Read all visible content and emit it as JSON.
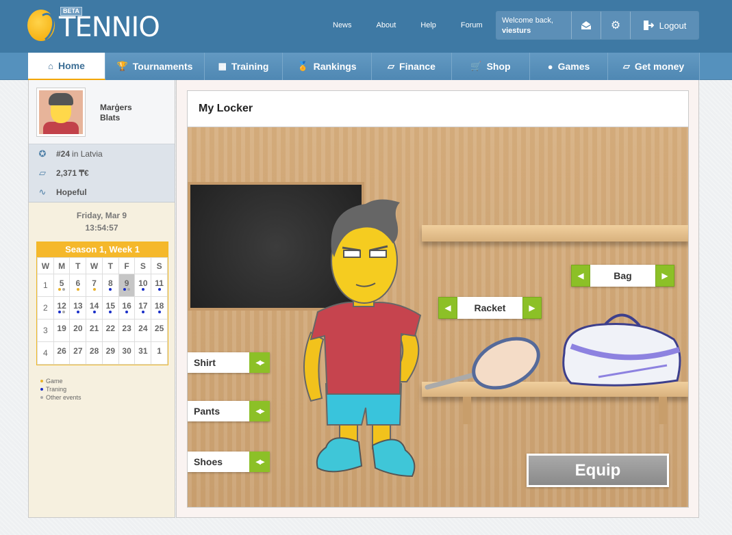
{
  "logo": {
    "text": "TENNIO",
    "badge": "BETA"
  },
  "toplinks": [
    "News",
    "About",
    "Help",
    "Forum"
  ],
  "user": {
    "welcome": "Welcome back,",
    "username": "viesturs",
    "logout": "Logout"
  },
  "nav": [
    {
      "label": "Home",
      "icon": "⌂",
      "width": 113,
      "active": true
    },
    {
      "label": "Tournaments",
      "icon": "🏆",
      "width": 145
    },
    {
      "label": "Training",
      "icon": "▦",
      "width": 114
    },
    {
      "label": "Rankings",
      "icon": "🏅",
      "width": 130
    },
    {
      "label": "Finance",
      "icon": "▱",
      "width": 117
    },
    {
      "label": "Shop",
      "icon": "🛒",
      "width": 114
    },
    {
      "label": "Games",
      "icon": "●",
      "width": 114
    },
    {
      "label": "Get money",
      "icon": "▱",
      "width": 134
    }
  ],
  "profile": {
    "first": "Marģers",
    "last": "Blats"
  },
  "stats": {
    "rank": "#24",
    "country": "in Latvia",
    "money": "2,371 ₸€",
    "status": "Hopeful"
  },
  "date": {
    "day": "Friday, Mar 9",
    "time": "13:54:57"
  },
  "calendar": {
    "title": "Season 1, Week 1",
    "headers": [
      "W",
      "M",
      "T",
      "W",
      "T",
      "F",
      "S",
      "S"
    ],
    "weeks": [
      {
        "wk": "1",
        "days": [
          {
            "d": "5",
            "dots": "go"
          },
          {
            "d": "6",
            "dots": "g"
          },
          {
            "d": "7",
            "dots": "g"
          },
          {
            "d": "8",
            "dots": "t"
          },
          {
            "d": "9",
            "dots": "to",
            "today": true
          },
          {
            "d": "10",
            "dots": "t"
          },
          {
            "d": "11",
            "dots": "t"
          }
        ]
      },
      {
        "wk": "2",
        "days": [
          {
            "d": "12",
            "dots": "to"
          },
          {
            "d": "13",
            "dots": "t"
          },
          {
            "d": "14",
            "dots": "t"
          },
          {
            "d": "15",
            "dots": "t"
          },
          {
            "d": "16",
            "dots": "t"
          },
          {
            "d": "17",
            "dots": "t"
          },
          {
            "d": "18",
            "dots": "t"
          }
        ]
      },
      {
        "wk": "3",
        "days": [
          {
            "d": "19"
          },
          {
            "d": "20"
          },
          {
            "d": "21"
          },
          {
            "d": "22"
          },
          {
            "d": "23"
          },
          {
            "d": "24"
          },
          {
            "d": "25"
          }
        ]
      },
      {
        "wk": "4",
        "days": [
          {
            "d": "26"
          },
          {
            "d": "27"
          },
          {
            "d": "28"
          },
          {
            "d": "29"
          },
          {
            "d": "30"
          },
          {
            "d": "31"
          },
          {
            "d": "1"
          }
        ]
      }
    ],
    "legend": {
      "game": "Game",
      "training": "Traning",
      "other": "Other events"
    }
  },
  "locker": {
    "title": "My Locker",
    "racket": "Racket",
    "bag": "Bag",
    "shirt": "Shirt",
    "pants": "Pants",
    "shoes": "Shoes",
    "equip": "Equip"
  },
  "colors": {
    "header": "#3e79a4",
    "nav": "#5591bd",
    "accent": "#f5b82b",
    "arrow": "#8cc027"
  }
}
